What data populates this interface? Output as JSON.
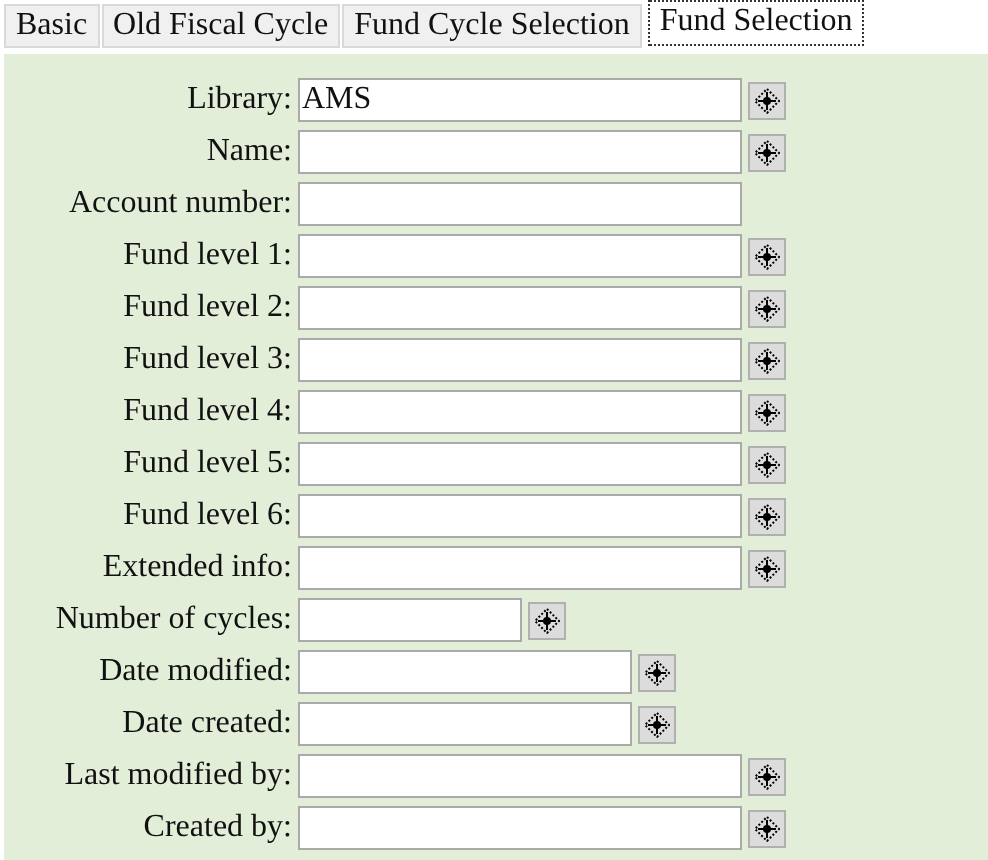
{
  "tabs": [
    {
      "label": "Basic",
      "selected": false
    },
    {
      "label": "Old Fiscal Cycle",
      "selected": false
    },
    {
      "label": "Fund Cycle Selection",
      "selected": false
    },
    {
      "label": "Fund Selection",
      "selected": true
    }
  ],
  "fields": [
    {
      "label": "Library:",
      "value": "AMS",
      "kind": "text",
      "lookup": true
    },
    {
      "label": "Name:",
      "kind": "text",
      "lookup": true
    },
    {
      "label": "Account number:",
      "kind": "text",
      "lookup": false
    },
    {
      "label": "Fund level 1:",
      "kind": "text",
      "lookup": true
    },
    {
      "label": "Fund level 2:",
      "kind": "text",
      "lookup": true
    },
    {
      "label": "Fund level 3:",
      "kind": "text",
      "lookup": true
    },
    {
      "label": "Fund level 4:",
      "kind": "text",
      "lookup": true
    },
    {
      "label": "Fund level 5:",
      "kind": "text",
      "lookup": true
    },
    {
      "label": "Fund level 6:",
      "kind": "text",
      "lookup": true
    },
    {
      "label": "Extended info:",
      "kind": "text",
      "lookup": true
    },
    {
      "label": "Number of cycles:",
      "kind": "number",
      "lookup": true
    },
    {
      "label": "Date modified:",
      "kind": "date",
      "lookup": true
    },
    {
      "label": "Date created:",
      "kind": "date",
      "lookup": true
    },
    {
      "label": "Last modified by:",
      "kind": "text",
      "lookup": true
    },
    {
      "label": "Created by:",
      "kind": "text",
      "lookup": true
    }
  ]
}
